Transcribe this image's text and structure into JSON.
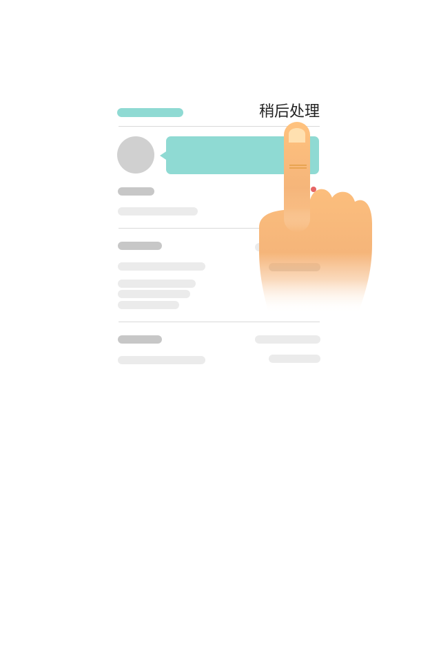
{
  "header": {
    "later_label": "稍后处理"
  },
  "colors": {
    "accent": "#8fdad3",
    "placeholder_dark": "#c7c7c7",
    "placeholder_light": "#ebebeb",
    "avatar": "#d0d0d0",
    "hand": "#f7b878"
  },
  "icons": {
    "pointer": "pointing-hand-icon"
  }
}
